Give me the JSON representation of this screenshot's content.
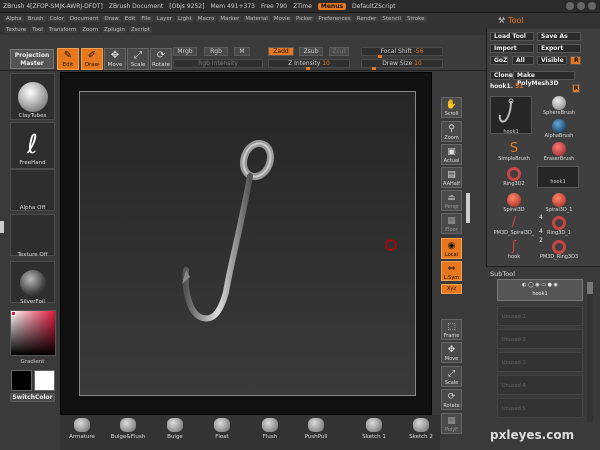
{
  "titlebar": {
    "app": "ZBrush 4[ZFOP-SMJK-AWRJ-DFDT]",
    "document": "ZBrush Document",
    "objs": "[Objs 9252]",
    "mem": "Mem 491+373",
    "free": "Free 790",
    "ztime": "ZTime",
    "menus": "Menus",
    "script": "DefaultZScript"
  },
  "menubar": [
    "Alpha",
    "Brush",
    "Color",
    "Document",
    "Draw",
    "Edit",
    "File",
    "Layer",
    "Light",
    "Macro",
    "Marker",
    "Material",
    "Movie",
    "Picker",
    "Preferences",
    "Render",
    "Stencil",
    "Stroke"
  ],
  "menubar2": [
    "Texture",
    "Tool",
    "Transform",
    "Zoom",
    "Zplugin",
    "Zscript"
  ],
  "toolbar": {
    "projection_master": "Projection Master",
    "edit": "Edit",
    "draw": "Draw",
    "move": "Move",
    "scale": "Scale",
    "rotate": "Rotate",
    "mrgb": "Mrgb",
    "rgb": "Rgb",
    "m": "M",
    "zadd": "Zadd",
    "zsub": "Zsub",
    "zcut": "Zcut",
    "focal_shift": "Focal Shift",
    "focal_shift_value": "-56",
    "rgb_intensity": "Rgb Intensity",
    "z_intensity": "Z Intensity",
    "z_intensity_value": "10",
    "draw_size": "Draw Size",
    "draw_size_value": "10"
  },
  "left_shelf": {
    "brush": "ClayTubes",
    "stroke": "FreeHand",
    "alpha": "Alpha Off",
    "texture": "Texture Off",
    "material": "SilverFoil",
    "gradient": "Gradient",
    "switch_color": "SwitchColor"
  },
  "right_shelf": [
    "Scroll",
    "Zoom",
    "Actual",
    "AAHalf",
    "Persp",
    "Floor",
    "Local",
    "L.Sym",
    "Xyz",
    "Frame",
    "Move",
    "Scale",
    "Rotate",
    "PolyF"
  ],
  "right_shelf_active": [
    "Local",
    "L.Sym",
    "Xyz"
  ],
  "bottom_shelf": [
    "Armature",
    "Bulge&Flush",
    "Bulge",
    "Float",
    "Flush",
    "PushPull",
    "Sketch 1",
    "Sketch 2"
  ],
  "tool_panel": {
    "title": "Tool",
    "load_tool": "Load Tool",
    "save_as": "Save As",
    "import": "Import",
    "export": "Export",
    "goz": "GoZ",
    "all": "All",
    "visible": "Visible",
    "r": "R",
    "clone": "Clone",
    "make_polymesh": "Make PolyMesh3D",
    "current_tool": "hook1",
    "current_tool_value": "51",
    "tools": [
      {
        "name": "hook1",
        "count": ""
      },
      {
        "name": "SphereBrush",
        "count": ""
      },
      {
        "name": "AlphaBrush",
        "count": ""
      },
      {
        "name": "SimpleBrush",
        "count": ""
      },
      {
        "name": "EraserBrush",
        "count": ""
      },
      {
        "name": "Ring3D2",
        "count": ""
      },
      {
        "name": "hook1",
        "count": ""
      },
      {
        "name": "Spiral3D",
        "count": ""
      },
      {
        "name": "Spiral3D_1",
        "count": ""
      },
      {
        "name": "PM3D_Spiral3D_",
        "count": "4"
      },
      {
        "name": "Ring3D_1",
        "count": "4"
      },
      {
        "name": "hook",
        "count": "2"
      },
      {
        "name": "PM3D_Ring3D3",
        "count": "2"
      }
    ]
  },
  "subtool": {
    "title": "SubTool",
    "active": "hook1",
    "unused": [
      "Unused 1",
      "Unused 2",
      "Unused 3",
      "Unused 4",
      "Unused 5"
    ]
  },
  "watermark": "pxleyes.com",
  "colors": {
    "accent": "#e8781e",
    "background": "#3a3a3a",
    "canvas": "#111111"
  }
}
